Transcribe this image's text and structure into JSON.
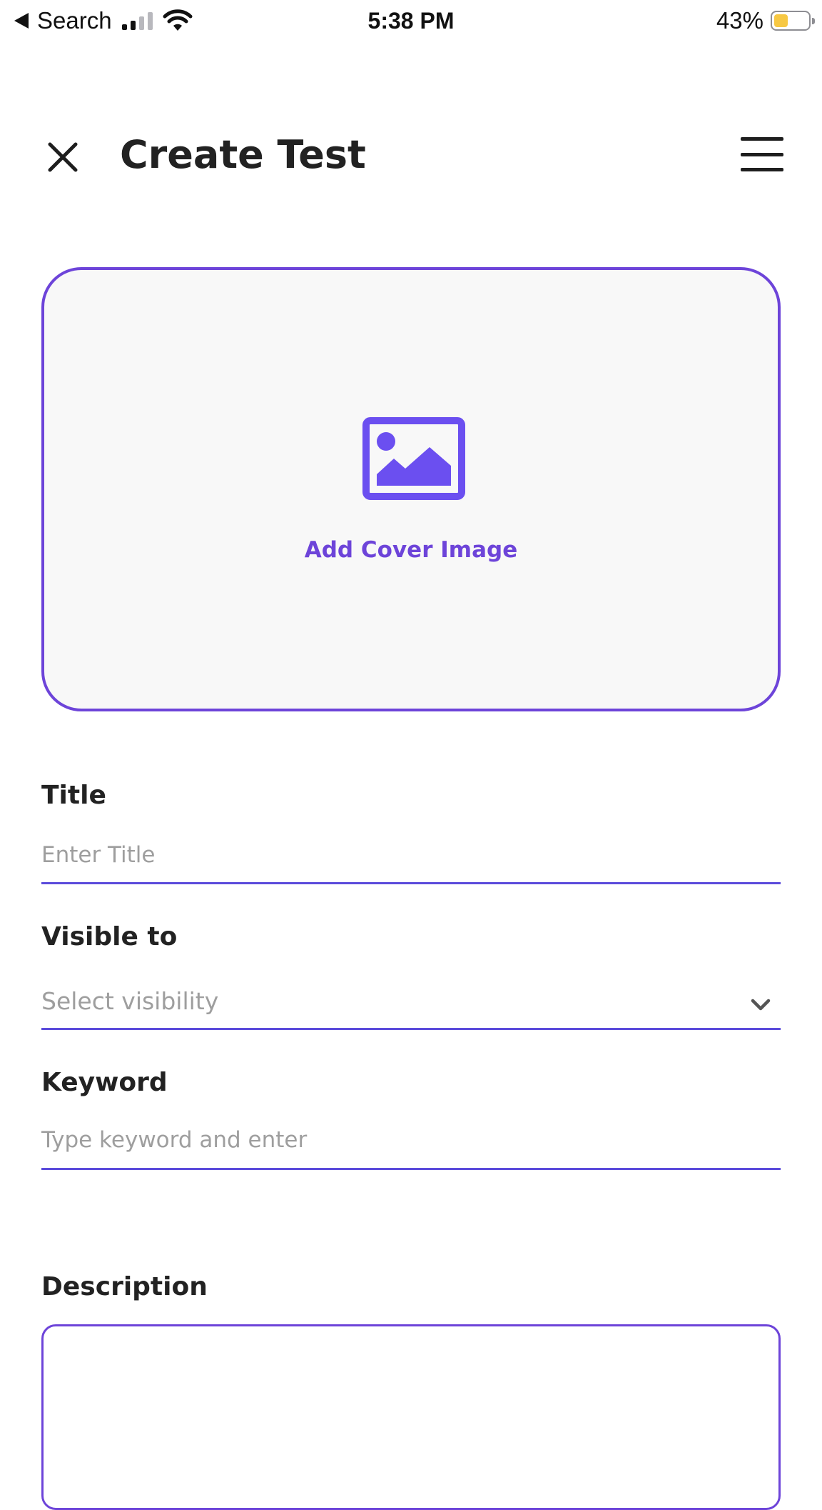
{
  "status_bar": {
    "back_label": "Search",
    "time": "5:38 PM",
    "battery_percent_text": "43%",
    "battery_level": 0.43,
    "signal_bars_active": 2,
    "signal_bars_total": 4
  },
  "header": {
    "title": "Create Test",
    "close_icon": "close-icon",
    "menu_icon": "hamburger-menu-icon"
  },
  "cover": {
    "label": "Add Cover Image",
    "icon": "image-icon"
  },
  "fields": {
    "title": {
      "label": "Title",
      "placeholder": "Enter Title",
      "value": ""
    },
    "visibility": {
      "label": "Visible to",
      "placeholder": "Select visibility",
      "icon": "chevron-down-icon"
    },
    "keyword": {
      "label": "Keyword",
      "placeholder": "Type keyword and enter",
      "value": ""
    },
    "description": {
      "label": "Description",
      "value": ""
    }
  },
  "colors": {
    "accent": "#6d44d9",
    "underline": "#5b4bdb",
    "icon_fill": "#6b4ff0",
    "placeholder": "#9e9e9e",
    "battery_fill": "#f7c843",
    "signal_active": "#111111",
    "signal_inactive": "#b8b8bd"
  }
}
